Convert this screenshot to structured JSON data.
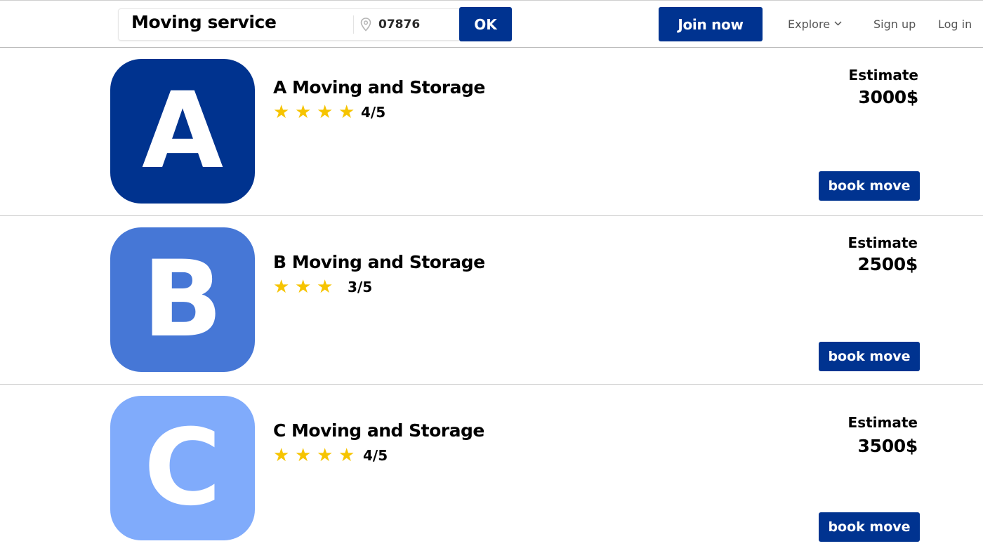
{
  "header": {
    "search_query": "Moving service",
    "zip": "07876",
    "ok_label": "OK",
    "join_label": "Join now",
    "explore_label": "Explore",
    "signup_label": "Sign up",
    "login_label": "Log in",
    "icons": [
      "map-pin-icon",
      "chevron-down-icon"
    ]
  },
  "colors": {
    "brand": "#003390",
    "star": "#f6c400",
    "logo_a": "#00338f",
    "logo_b": "#4677d6",
    "logo_c": "#80abfb"
  },
  "listings": [
    {
      "logo_letter": "A",
      "name": "A Moving and Storage",
      "stars": 4,
      "rating": "4/5",
      "estimate_label": "Estimate",
      "estimate_value": "3000$",
      "book_label": "book move"
    },
    {
      "logo_letter": "B",
      "name": "B Moving and Storage",
      "stars": 3,
      "rating": "3/5",
      "estimate_label": "Estimate",
      "estimate_value": "2500$",
      "book_label": "book move"
    },
    {
      "logo_letter": "C",
      "name": "C Moving and Storage",
      "stars": 4,
      "rating": "4/5",
      "estimate_label": "Estimate",
      "estimate_value": "3500$",
      "book_label": "book move"
    }
  ]
}
